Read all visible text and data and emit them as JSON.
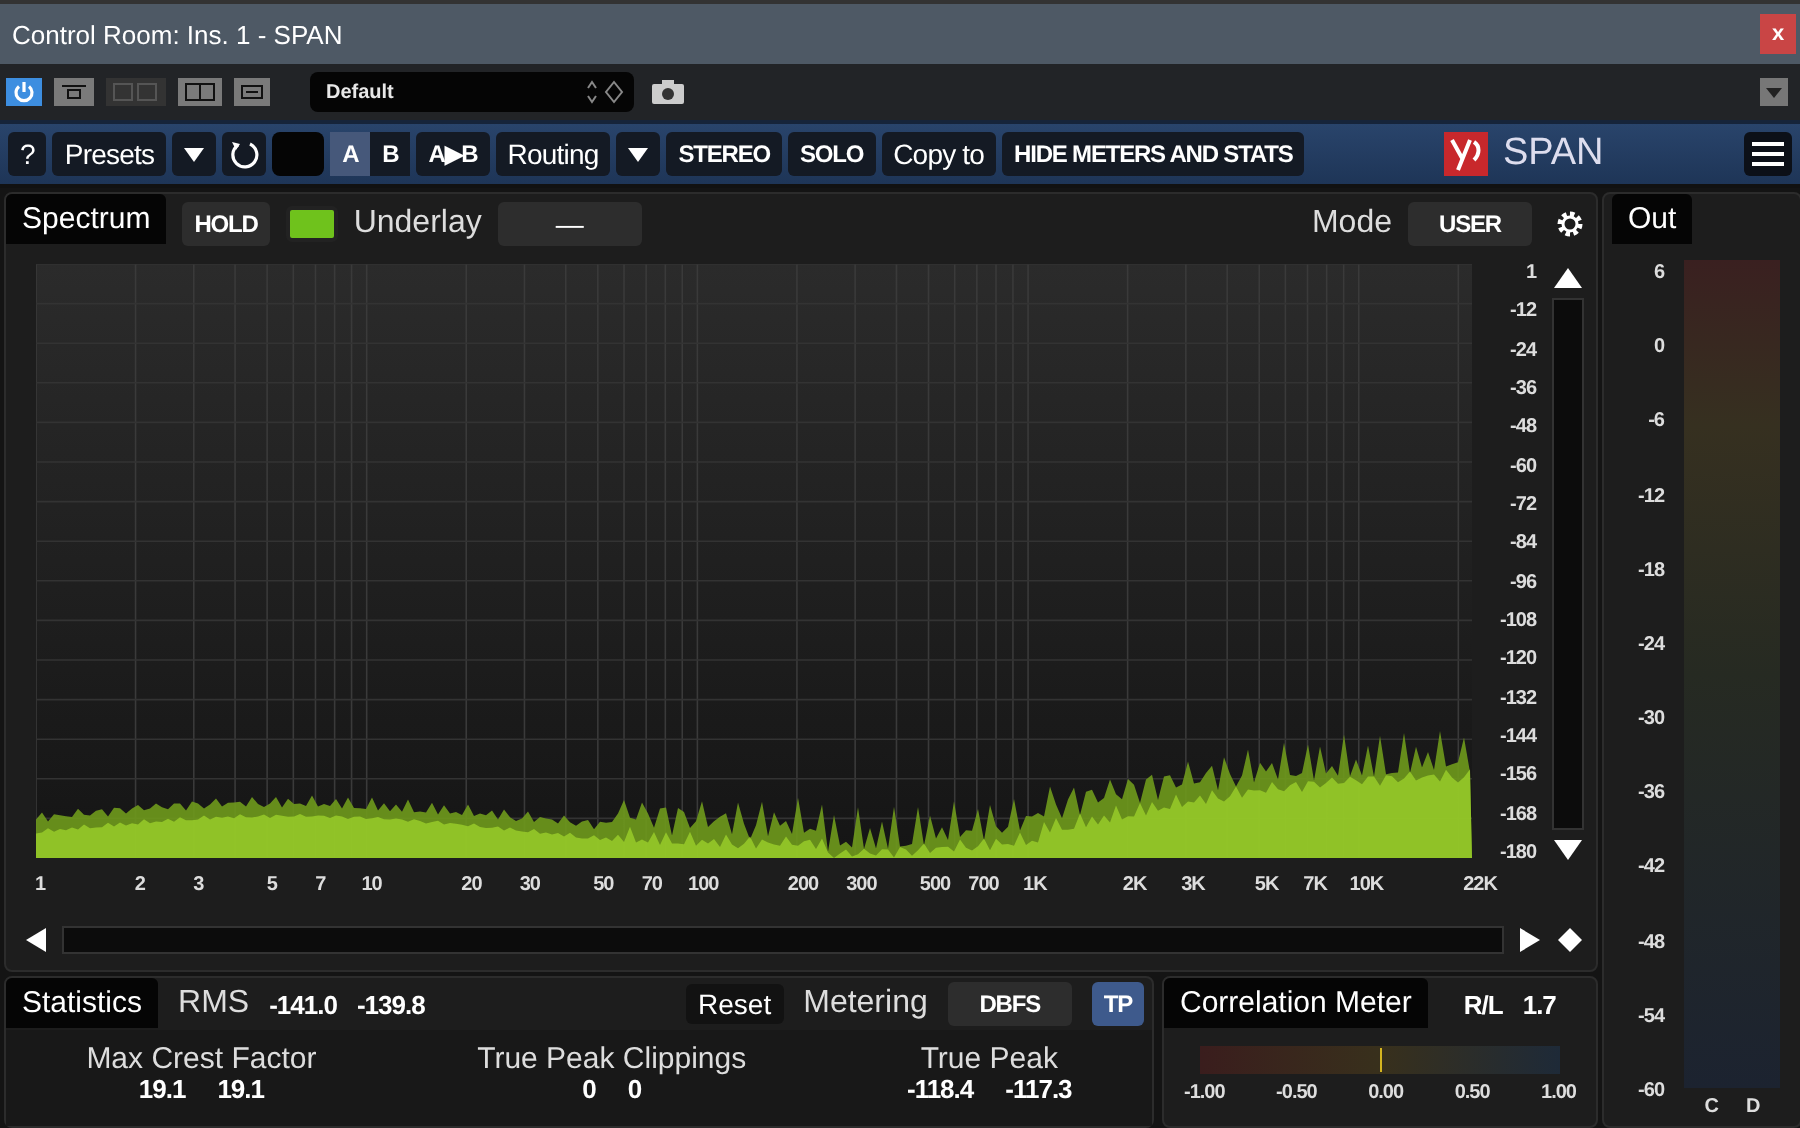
{
  "window": {
    "title": "Control Room: Ins. 1 - SPAN",
    "close": "x"
  },
  "host_toolbar": {
    "power_on": true,
    "preset": "Default"
  },
  "toolbar": {
    "help": "?",
    "presets": "Presets",
    "ab": [
      {
        "label": "A",
        "selected": true
      },
      {
        "label": "B",
        "selected": false
      }
    ],
    "copy_ab": "A▶B",
    "routing": "Routing",
    "stereo": "STEREO",
    "solo": "SOLO",
    "copy_to": "Copy to",
    "hide": "HIDE METERS AND STATS",
    "logo": "SPAN"
  },
  "spectrum": {
    "tab": "Spectrum",
    "hold": "HOLD",
    "underlay_on": true,
    "underlay_label": "Underlay",
    "underlay_value": "—",
    "mode_label": "Mode",
    "mode": "USER",
    "db_labels": [
      "1",
      "-12",
      "-24",
      "-36",
      "-48",
      "-60",
      "-72",
      "-84",
      "-96",
      "-108",
      "-120",
      "-132",
      "-144",
      "-156",
      "-168",
      "-180"
    ],
    "freq_labels": [
      "1",
      "2",
      "3",
      "5",
      "7",
      "10",
      "20",
      "30",
      "50",
      "70",
      "100",
      "200",
      "300",
      "500",
      "700",
      "1K",
      "2K",
      "3K",
      "5K",
      "7K",
      "10K",
      "22K"
    ]
  },
  "out": {
    "tab": "Out",
    "scale": [
      "6",
      "0",
      "-6",
      "-12",
      "-18",
      "-24",
      "-30",
      "-36",
      "-42",
      "-48",
      "-54",
      "-60"
    ],
    "channels": [
      "C",
      "D"
    ]
  },
  "statistics": {
    "tab": "Statistics",
    "rms_label": "RMS",
    "rms": [
      "-141.0",
      "-139.8"
    ],
    "reset": "Reset",
    "metering_label": "Metering",
    "metering": "DBFS",
    "tp": {
      "label": "TP",
      "on": true
    },
    "groups": [
      {
        "label": "Max Crest Factor",
        "values": [
          "19.1",
          "19.1"
        ]
      },
      {
        "label": "True Peak Clippings",
        "values": [
          "0",
          "0"
        ]
      },
      {
        "label": "True Peak",
        "values": [
          "-118.4",
          "-117.3"
        ]
      }
    ]
  },
  "correlation": {
    "tab": "Correlation Meter",
    "rl_label": "R/L",
    "rl_value": "1.7",
    "level": 0.5,
    "scale": [
      "-1.00",
      "-0.50",
      "0.00",
      "0.50",
      "1.00"
    ]
  }
}
